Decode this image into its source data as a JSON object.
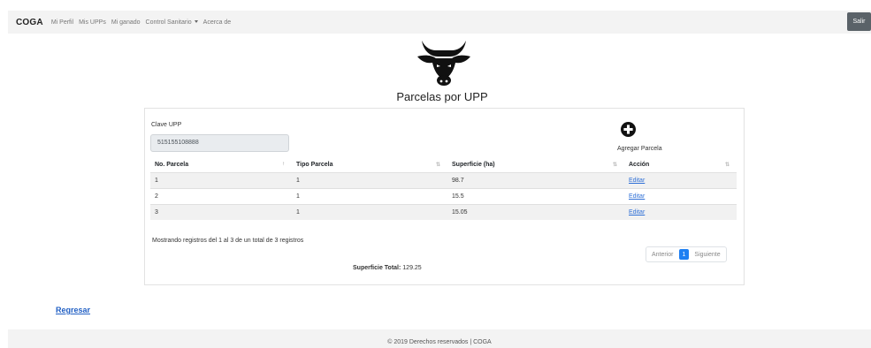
{
  "navbar": {
    "brand": "COGA",
    "links": [
      "Mi Perfil",
      "Mis UPPs",
      "Mi ganado",
      "Control Sanitario",
      "Acerca de"
    ],
    "logout": "Salir"
  },
  "page": {
    "title": "Parcelas por UPP"
  },
  "form": {
    "upp_label": "Clave UPP",
    "upp_value": "515155108888",
    "add_label": "Agregar Parcela"
  },
  "table": {
    "columns": [
      "No. Parcela",
      "Tipo Parcela",
      "Superficie (ha)",
      "Acción"
    ],
    "rows": [
      {
        "no": "1",
        "tipo": "1",
        "superficie": "98.7",
        "accion": "Editar"
      },
      {
        "no": "2",
        "tipo": "1",
        "superficie": "15.5",
        "accion": "Editar"
      },
      {
        "no": "3",
        "tipo": "1",
        "superficie": "15.05",
        "accion": "Editar"
      }
    ]
  },
  "summary": {
    "info": "Mostrando registros del 1 al 3 de un total de 3 registros",
    "total_label": "Superficie Total:",
    "total_value": "129.25"
  },
  "pagination": {
    "prev": "Anterior",
    "current": "1",
    "next": "Siguiente"
  },
  "back_link": "Regresar",
  "footer": "© 2019 Derechos reservados | COGA",
  "colors": {
    "navbar_bg": "#f3f3f3",
    "link": "#2e6fd6",
    "page_active": "#1e7ff2"
  }
}
